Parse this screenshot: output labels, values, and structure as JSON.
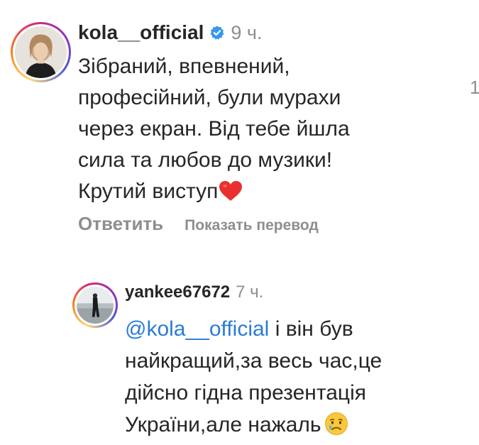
{
  "comments": [
    {
      "username": "kola__official",
      "verified": true,
      "time": "9 ч.",
      "lines": [
        "Зібраний, впевнений,",
        "професійний, були мурахи",
        "через екран. Від тебе йшла",
        "сила та любов до музики!",
        "Крутий виступ"
      ],
      "emoji": "red-heart",
      "side_count": "1",
      "actions": {
        "reply": "Ответить",
        "translate": "Показать перевод"
      }
    },
    {
      "username": "yankee67672",
      "verified": false,
      "time": "7 ч.",
      "mention": "@kola__official",
      "lines": [
        "і він був",
        "найкращий,за весь час,це",
        "дійсно гідна презентація",
        "України,але нажаль"
      ],
      "emoji": "crying-face"
    }
  ],
  "colors": {
    "text": "#262626",
    "muted": "#8e8e8e",
    "mention": "#2b7bd6",
    "verified": "#3897f0"
  }
}
